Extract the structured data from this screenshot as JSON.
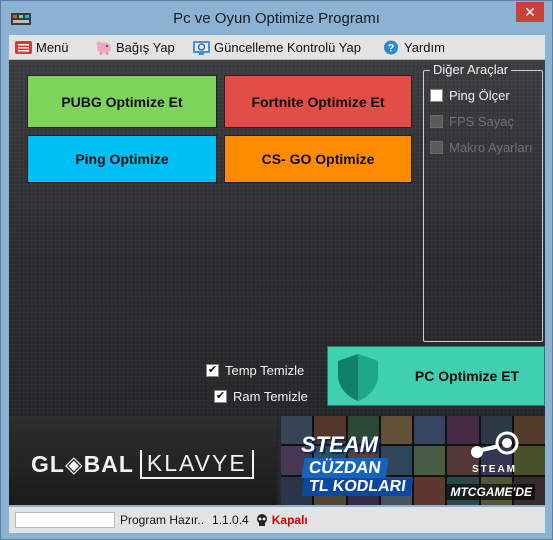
{
  "window": {
    "title": "Pc ve Oyun Optimize Programı",
    "close_glyph": "✕"
  },
  "menu": [
    {
      "label": "Menü",
      "icon": "menu-icon"
    },
    {
      "label": "Bağış Yap",
      "icon": "piggy-bank-icon"
    },
    {
      "label": "Güncelleme Kontrolü Yap",
      "icon": "update-icon"
    },
    {
      "label": "Yardım",
      "icon": "help-icon"
    }
  ],
  "buttons": {
    "pubg": {
      "label": "PUBG Optimize Et",
      "color": "#7ed35a"
    },
    "fortnite": {
      "label": "Fortnite Optimize Et",
      "color": "#e24d47"
    },
    "ping": {
      "label": "Ping Optimize",
      "color": "#00bff5"
    },
    "csgo": {
      "label": "CS- GO Optimize",
      "color": "#ff8c00"
    },
    "pc": {
      "label": "PC Optimize ET",
      "color": "#3fcfb1"
    }
  },
  "other_tools": {
    "title": "Diğer Araçlar",
    "items": [
      {
        "label": "Ping Ölçer",
        "checked": false,
        "enabled": true
      },
      {
        "label": "FPS Sayaç",
        "checked": false,
        "enabled": false
      },
      {
        "label": "Makro Ayarları",
        "checked": false,
        "enabled": false
      }
    ]
  },
  "cleaning": [
    {
      "label": "Temp Temizle",
      "checked": true
    },
    {
      "label": "Ram Temizle",
      "checked": true
    }
  ],
  "banners": {
    "left": {
      "brand": "GL◈BAL",
      "brand2": "KLAVYE"
    },
    "right": {
      "title": "STEAM",
      "line1": "CÜZDAN",
      "line2": "TL KODLARI",
      "logo_text": "STEAM",
      "site": "MTCGAME'DE"
    }
  },
  "status": {
    "progress": 0,
    "text": "Program Hazır..",
    "version": "1.1.0.4",
    "state": "Kapalı"
  }
}
